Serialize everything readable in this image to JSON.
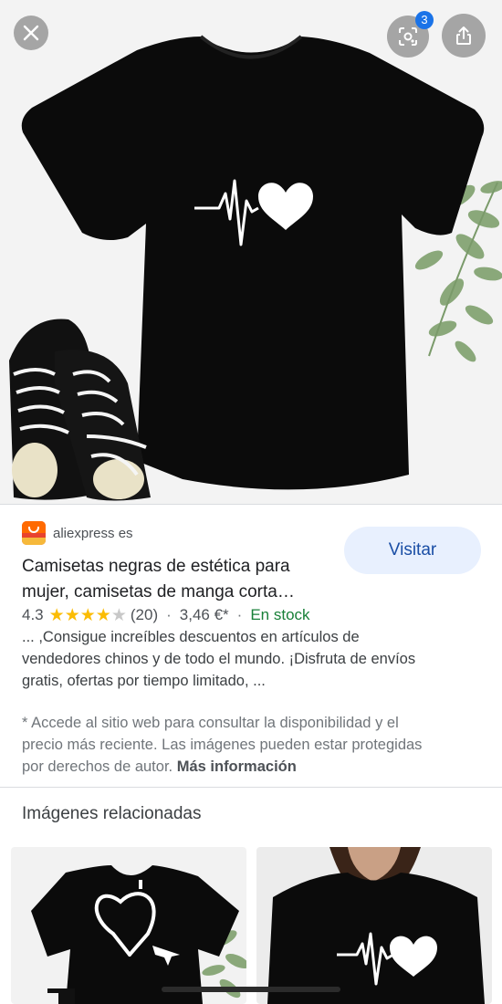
{
  "viewer": {
    "lens_badge_count": "3",
    "icons": {
      "close": "close-icon",
      "lens": "lens-icon",
      "share": "share-icon"
    }
  },
  "result": {
    "source": "aliexpress es",
    "favicon": "aliexpress-logo",
    "title_line1": "Camisetas negras de estética para",
    "title_line2": "mujer, camisetas de manga corta…",
    "rating": "4.3",
    "rating_value": 4.3,
    "rating_max": 5,
    "reviews": "(20)",
    "price": "3,46 €*",
    "stock": "En stock",
    "snippet_line1": "... ,Consigue increíbles descuentos en artículos de",
    "snippet_line2": "vendedores chinos y de todo el mundo. ¡Disfruta de envíos",
    "snippet_line3": "gratis, ofertas por tiempo limitado, ...",
    "visit_label": "Visitar"
  },
  "disclaimer": {
    "line1": "* Accede al sitio web para consultar la disponibilidad y el",
    "line2": "precio más reciente. Las imágenes pueden estar protegidas",
    "line3": "por derechos de autor.",
    "more_info": "Más información"
  },
  "related": {
    "title": "Imágenes relacionadas"
  },
  "colors": {
    "accent": "#1a73e8",
    "visit_bg": "#e8f0fe",
    "stock_green": "#188038",
    "star": "#fbbc04"
  }
}
